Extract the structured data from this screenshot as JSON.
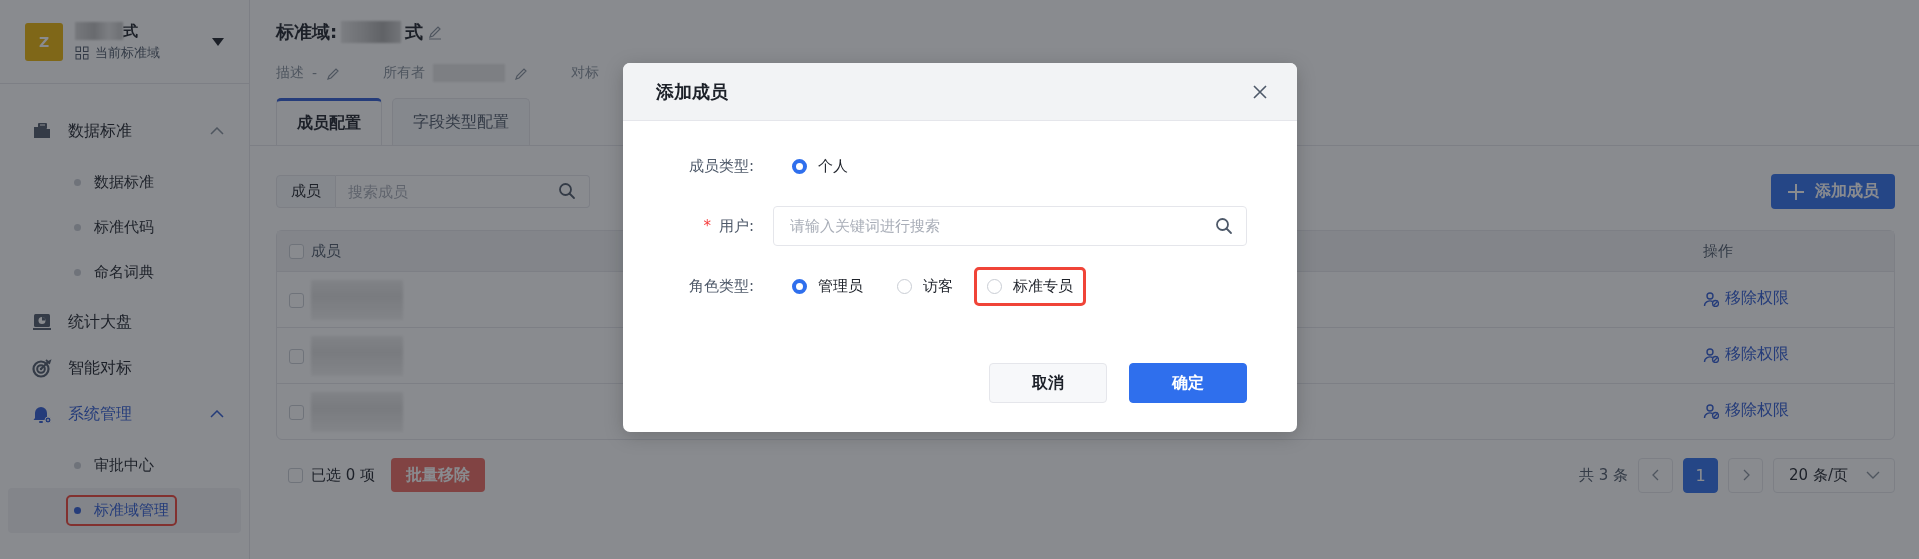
{
  "workspace": {
    "avatar_letter": "Z",
    "name": "式",
    "subtitle": "当前标准域"
  },
  "sidebar": {
    "items": [
      {
        "label": "数据标准",
        "selected": false,
        "expanded": true,
        "children": [
          {
            "label": "数据标准",
            "selected": false,
            "highlighted": false
          },
          {
            "label": "标准代码",
            "selected": false,
            "highlighted": false
          },
          {
            "label": "命名词典",
            "selected": false,
            "highlighted": false
          }
        ]
      },
      {
        "label": "统计大盘",
        "selected": false
      },
      {
        "label": "智能对标",
        "selected": false
      },
      {
        "label": "系统管理",
        "selected": true,
        "expanded": true,
        "children": [
          {
            "label": "审批中心",
            "selected": false,
            "highlighted": false
          },
          {
            "label": "标准域管理",
            "selected": true,
            "highlighted": true
          }
        ]
      }
    ]
  },
  "header": {
    "title_label": "标准域:",
    "title_value": "式",
    "meta": [
      {
        "label": "描述",
        "value": "-"
      },
      {
        "label": "所有者"
      },
      {
        "label": "对标"
      }
    ]
  },
  "tabs": [
    {
      "label": "成员配置",
      "selected": true
    },
    {
      "label": "字段类型配置",
      "selected": false
    }
  ],
  "search": {
    "prefix": "成员",
    "placeholder": "搜索成员"
  },
  "add_button": "添加成员",
  "table": {
    "header_checked": false,
    "columns": [
      "成员",
      "操作"
    ],
    "rows": [
      {
        "checked": false,
        "action": "移除权限"
      },
      {
        "checked": false,
        "action": "移除权限"
      },
      {
        "checked": false,
        "action": "移除权限"
      }
    ]
  },
  "footer": {
    "select_all": false,
    "selected_text": "已选 0 项",
    "batch_button": {
      "label": "批量移除",
      "disabled": true
    }
  },
  "pagination": {
    "total": "共 3 条",
    "pages": [
      {
        "label": "1",
        "selected": true
      }
    ],
    "page_size": "20 条/页"
  },
  "dialog": {
    "title": "添加成员",
    "fields": [
      {
        "kind": "radio",
        "label": "成员类型:",
        "required": false,
        "options": [
          {
            "label": "个人",
            "selected": true,
            "highlighted": false
          }
        ]
      },
      {
        "kind": "search",
        "label": "用户:",
        "required": true,
        "required_mark": "*",
        "placeholder": "请输入关键词进行搜索"
      },
      {
        "kind": "radio",
        "label": "角色类型:",
        "required": false,
        "options": [
          {
            "label": "管理员",
            "selected": true,
            "highlighted": false
          },
          {
            "label": "访客",
            "selected": false,
            "highlighted": false
          },
          {
            "label": "标准专员",
            "selected": false,
            "highlighted": true
          }
        ]
      }
    ],
    "buttons": [
      {
        "label": "取消",
        "kind": "secondary"
      },
      {
        "label": "确定",
        "kind": "primary"
      }
    ]
  }
}
